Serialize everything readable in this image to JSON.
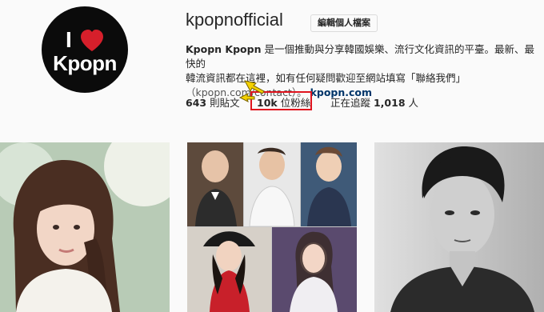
{
  "profile": {
    "username": "kpopnofficial",
    "edit_button_label": "編輯個人檔案",
    "logo_top": "I",
    "logo_word": "Kpopn",
    "bio_name": "Kpopn Kpopn",
    "bio_text_1": " 是一個推動與分享韓國娛樂、流行文化資訊的平臺。最新、最快的",
    "bio_text_2": "韓流資訊都在這裡，如有任何疑問歡迎至網站填寫「聯絡我們」",
    "bio_contact": "（kpopn.com/contact）。",
    "bio_link": "kpopn.com"
  },
  "stats": {
    "posts_value": "643",
    "posts_label": " 則貼文",
    "followers_value": "10k",
    "followers_label": " 位粉絲",
    "following_label": "正在追蹤 ",
    "following_value": "1,018",
    "following_suffix": " 人"
  },
  "colors": {
    "highlight_box": "#e0141e",
    "arrow_fill": "#f4d100",
    "link": "#003569"
  },
  "grid": {
    "photos": [
      {
        "icon": "woman-portrait-photo"
      },
      {
        "icon": "collage-photo"
      },
      {
        "icon": "man-portrait-photo"
      }
    ]
  }
}
